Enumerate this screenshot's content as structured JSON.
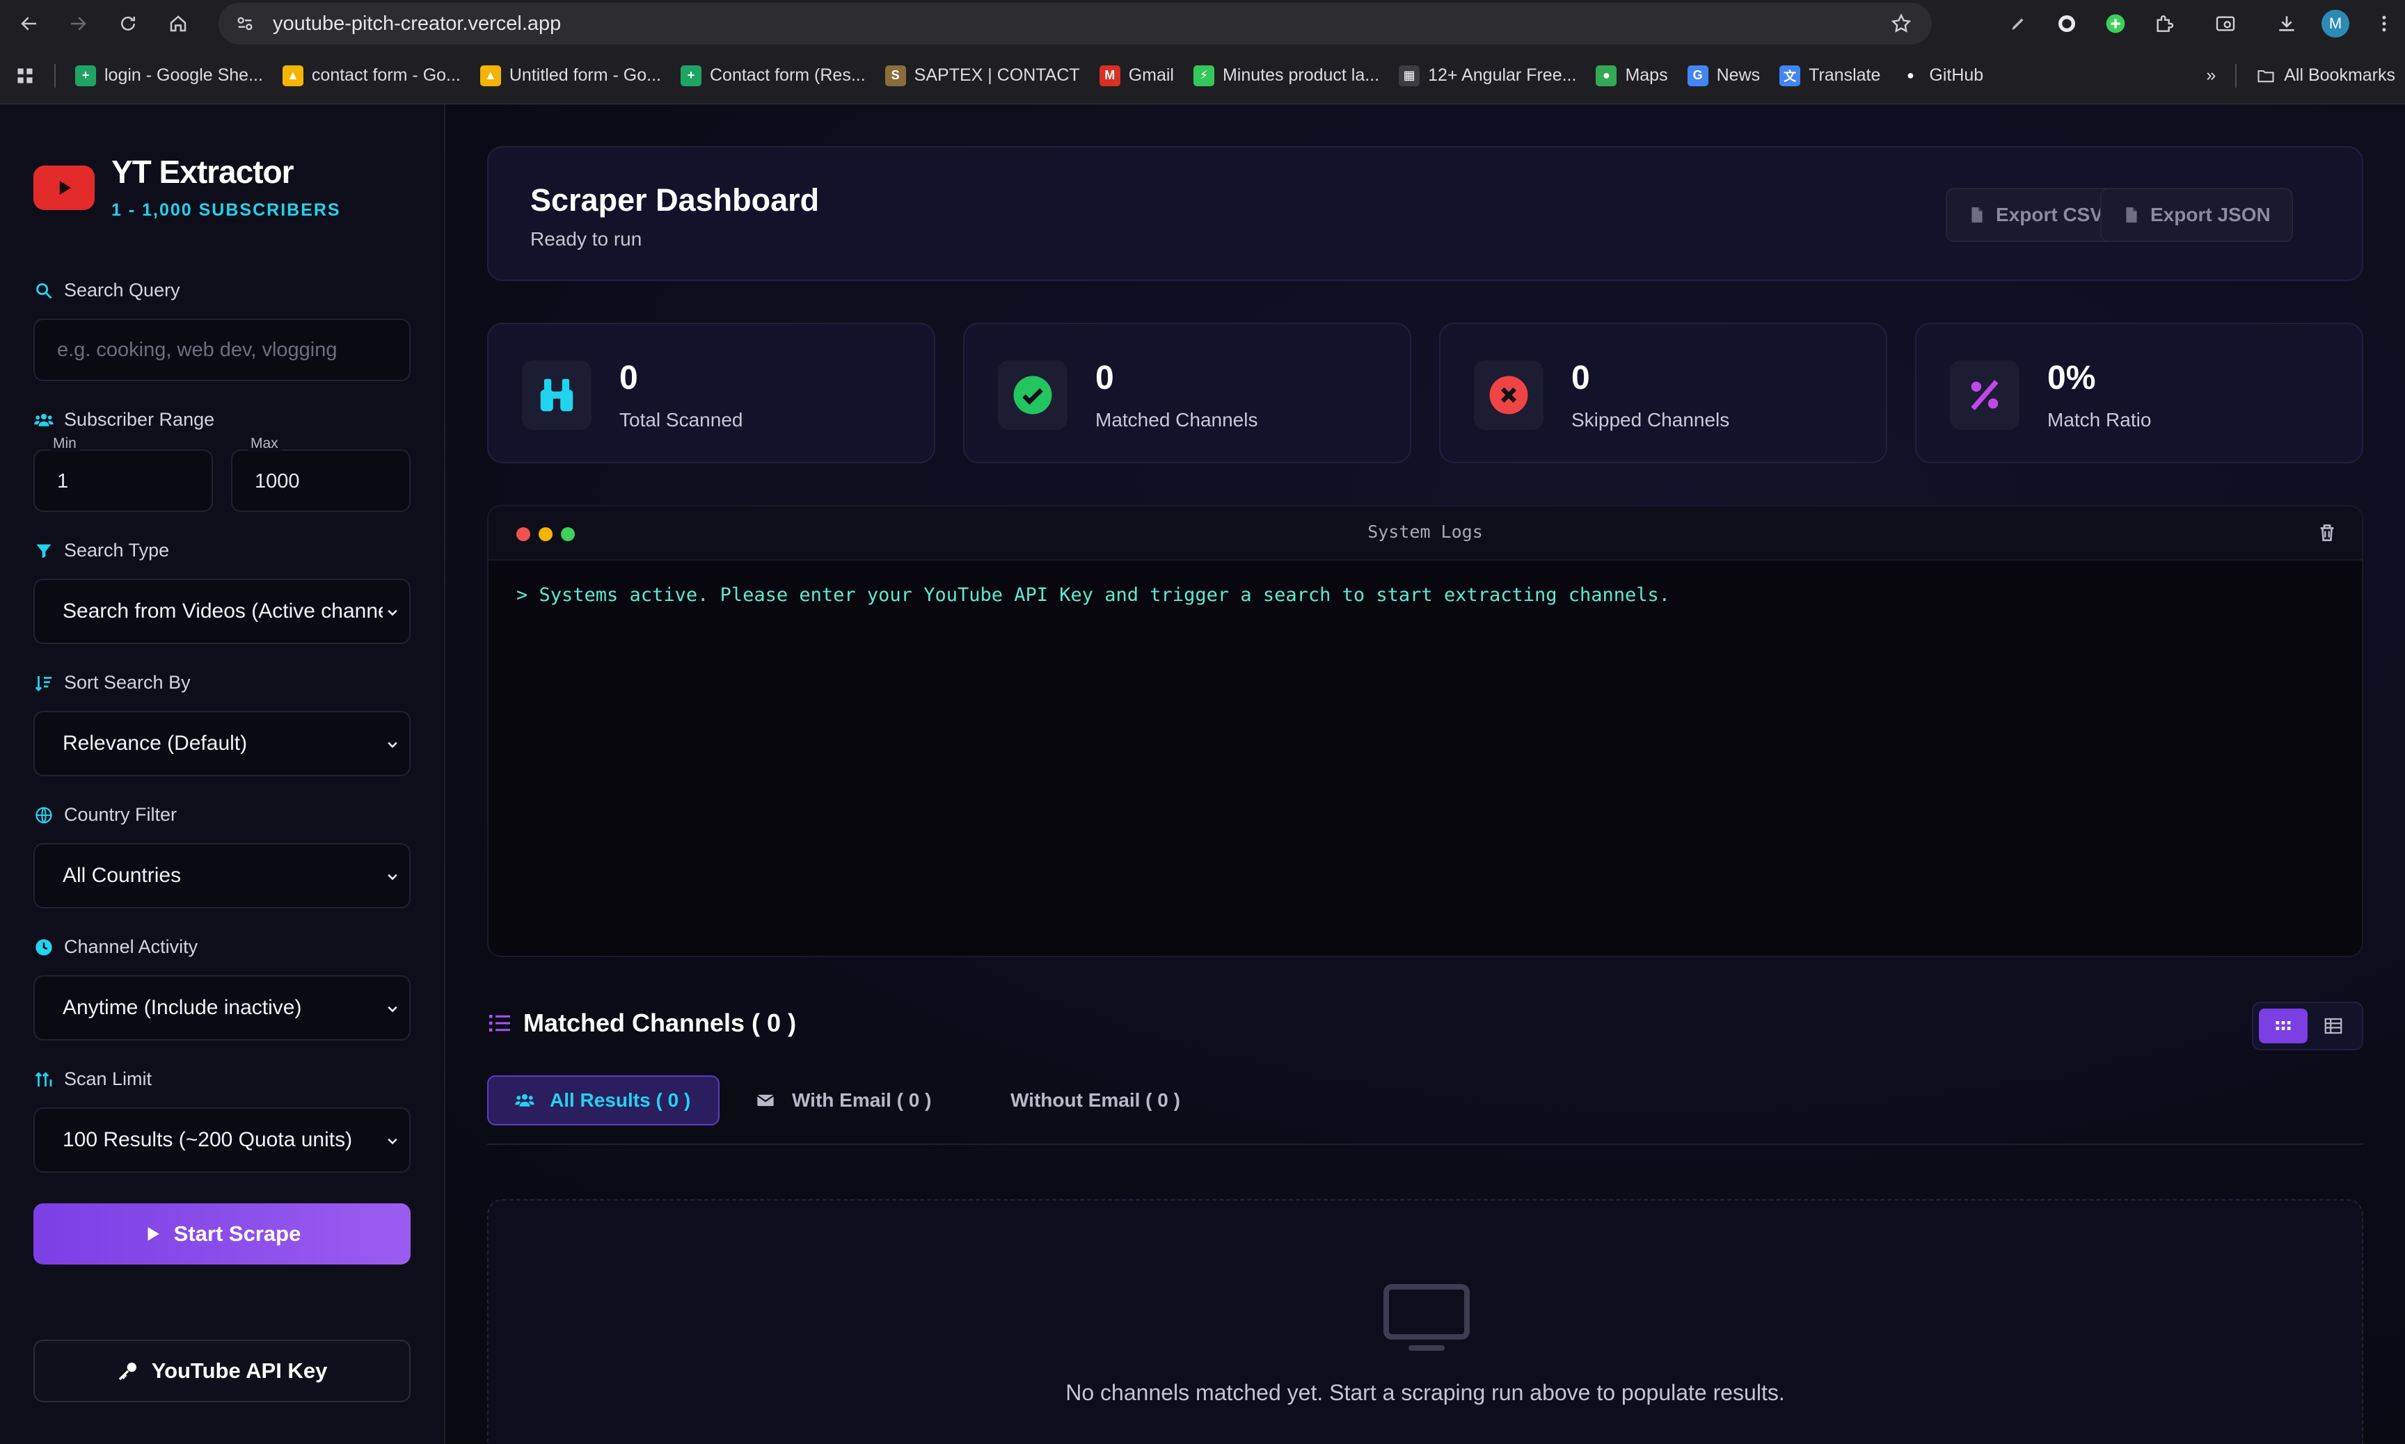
{
  "browser": {
    "url": "youtube-pitch-creator.vercel.app",
    "avatar_letter": "M",
    "bookmarks": [
      {
        "label": "login - Google She...",
        "color": "#1fa463",
        "glyph": "+"
      },
      {
        "label": "contact form - Go...",
        "color": "#f4b400",
        "glyph": "▲"
      },
      {
        "label": "Untitled form - Go...",
        "color": "#f4b400",
        "glyph": "▲"
      },
      {
        "label": "Contact form (Res...",
        "color": "#1fa463",
        "glyph": "+"
      },
      {
        "label": "SAPTEX | CONTACT",
        "color": "#8a6d3b",
        "glyph": "S"
      },
      {
        "label": "Gmail",
        "color": "#d93025",
        "glyph": "M"
      },
      {
        "label": "Minutes product la...",
        "color": "#34c759",
        "glyph": "⚡"
      },
      {
        "label": "12+ Angular Free...",
        "color": "#3c3c42",
        "glyph": "▦"
      },
      {
        "label": "Maps",
        "color": "#34a853",
        "glyph": "●"
      },
      {
        "label": "News",
        "color": "#4285f4",
        "glyph": "G"
      },
      {
        "label": "Translate",
        "color": "#4285f4",
        "glyph": "文"
      },
      {
        "label": "GitHub",
        "color": "#1f1f23",
        "glyph": "●"
      }
    ],
    "all_bookmarks": "All Bookmarks"
  },
  "sidebar": {
    "brand_title": "YT Extractor",
    "brand_subtitle": "1 - 1,000 SUBSCRIBERS",
    "search_label": "Search Query",
    "search_placeholder": "e.g. cooking, web dev, vlogging",
    "subscriber_label": "Subscriber Range",
    "min_label": "Min",
    "min_value": "1",
    "max_label": "Max",
    "max_value": "1000",
    "search_type_label": "Search Type",
    "search_type_value": "Search from Videos (Active channe",
    "sort_label": "Sort Search By",
    "sort_value": "Relevance (Default)",
    "country_label": "Country Filter",
    "country_value": "All Countries",
    "activity_label": "Channel Activity",
    "activity_value": "Anytime (Include inactive)",
    "scan_label": "Scan Limit",
    "scan_value": "100 Results (~200 Quota units)",
    "start_button": "Start Scrape",
    "api_button": "YouTube API Key"
  },
  "header": {
    "title": "Scraper Dashboard",
    "status": "Ready to run",
    "export_csv": "Export CSV",
    "export_json": "Export JSON"
  },
  "stats": [
    {
      "value": "0",
      "label": "Total Scanned"
    },
    {
      "value": "0",
      "label": "Matched Channels"
    },
    {
      "value": "0",
      "label": "Skipped Channels"
    },
    {
      "value": "0%",
      "label": "Match Ratio"
    }
  ],
  "logs": {
    "title": "System Logs",
    "line": "> Systems active. Please enter your YouTube API Key and trigger a search to start extracting channels."
  },
  "results": {
    "title": "Matched Channels ( 0 )",
    "tab_all": "All Results ( 0 )",
    "tab_email": "With Email ( 0 )",
    "tab_no_email": "Without Email ( 0 )",
    "empty_text": "No channels matched yet. Start a scraping run above to populate results."
  },
  "colors": {
    "accent": "#7b3fe4",
    "cyan": "#22d3ee",
    "success": "#22c55e",
    "danger": "#ef4444",
    "brand_red": "#e32b2b"
  }
}
